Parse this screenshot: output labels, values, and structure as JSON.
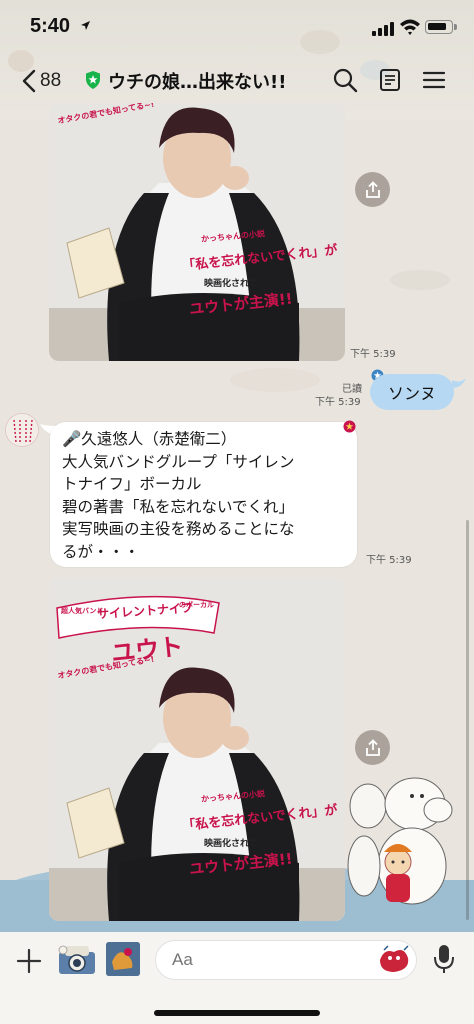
{
  "status_bar": {
    "time": "5:40",
    "location_icon": "location-arrow-icon",
    "battery_level": 0.85
  },
  "header": {
    "back_count": "88",
    "chat_title": "ウチの娘…出来ない!!",
    "icons": [
      "search-icon",
      "notes-icon",
      "menu-icon"
    ]
  },
  "messages": {
    "photo1": {
      "time": "下午 5:39",
      "caption_top": "オタクの君でも知ってる~!",
      "caption_book": "「私を忘れないでくれ」が",
      "caption_movie": "映画化されて",
      "caption_star": "ユウトが主演!!",
      "caption_author": "かっちゃんの小説"
    },
    "outgoing": {
      "read_label": "已讀",
      "time": "下午 5:39",
      "text": "ソンヌ"
    },
    "incoming": {
      "lines": [
        "🎤久遠悠人（赤楚衛二）",
        "大人気バンドグループ「サイレン",
        "トナイフ」ボーカル",
        "碧の著書「私を忘れないでくれ」",
        "実写映画の主役を務めることにな",
        "るが・・・"
      ],
      "time": "下午 5:39"
    },
    "photo2": {
      "banner_small": "超人気バンド",
      "banner_main": "サイレントナイフ",
      "banner_suffix": "のボーカル",
      "name_big": "ユウト",
      "caption_top": "オタクの君でも知ってる~!",
      "caption_author": "かっちゃんの小説",
      "caption_book": "「私を忘れないでくれ」が",
      "caption_movie": "映画化されて",
      "caption_star": "ユウトが主演!!"
    }
  },
  "input": {
    "placeholder": "Aa"
  },
  "colors": {
    "accent_pink": "#c8134c",
    "bubble_out": "#b6d8f2",
    "bubble_in": "#ffffff",
    "background": "#e9e5de"
  }
}
